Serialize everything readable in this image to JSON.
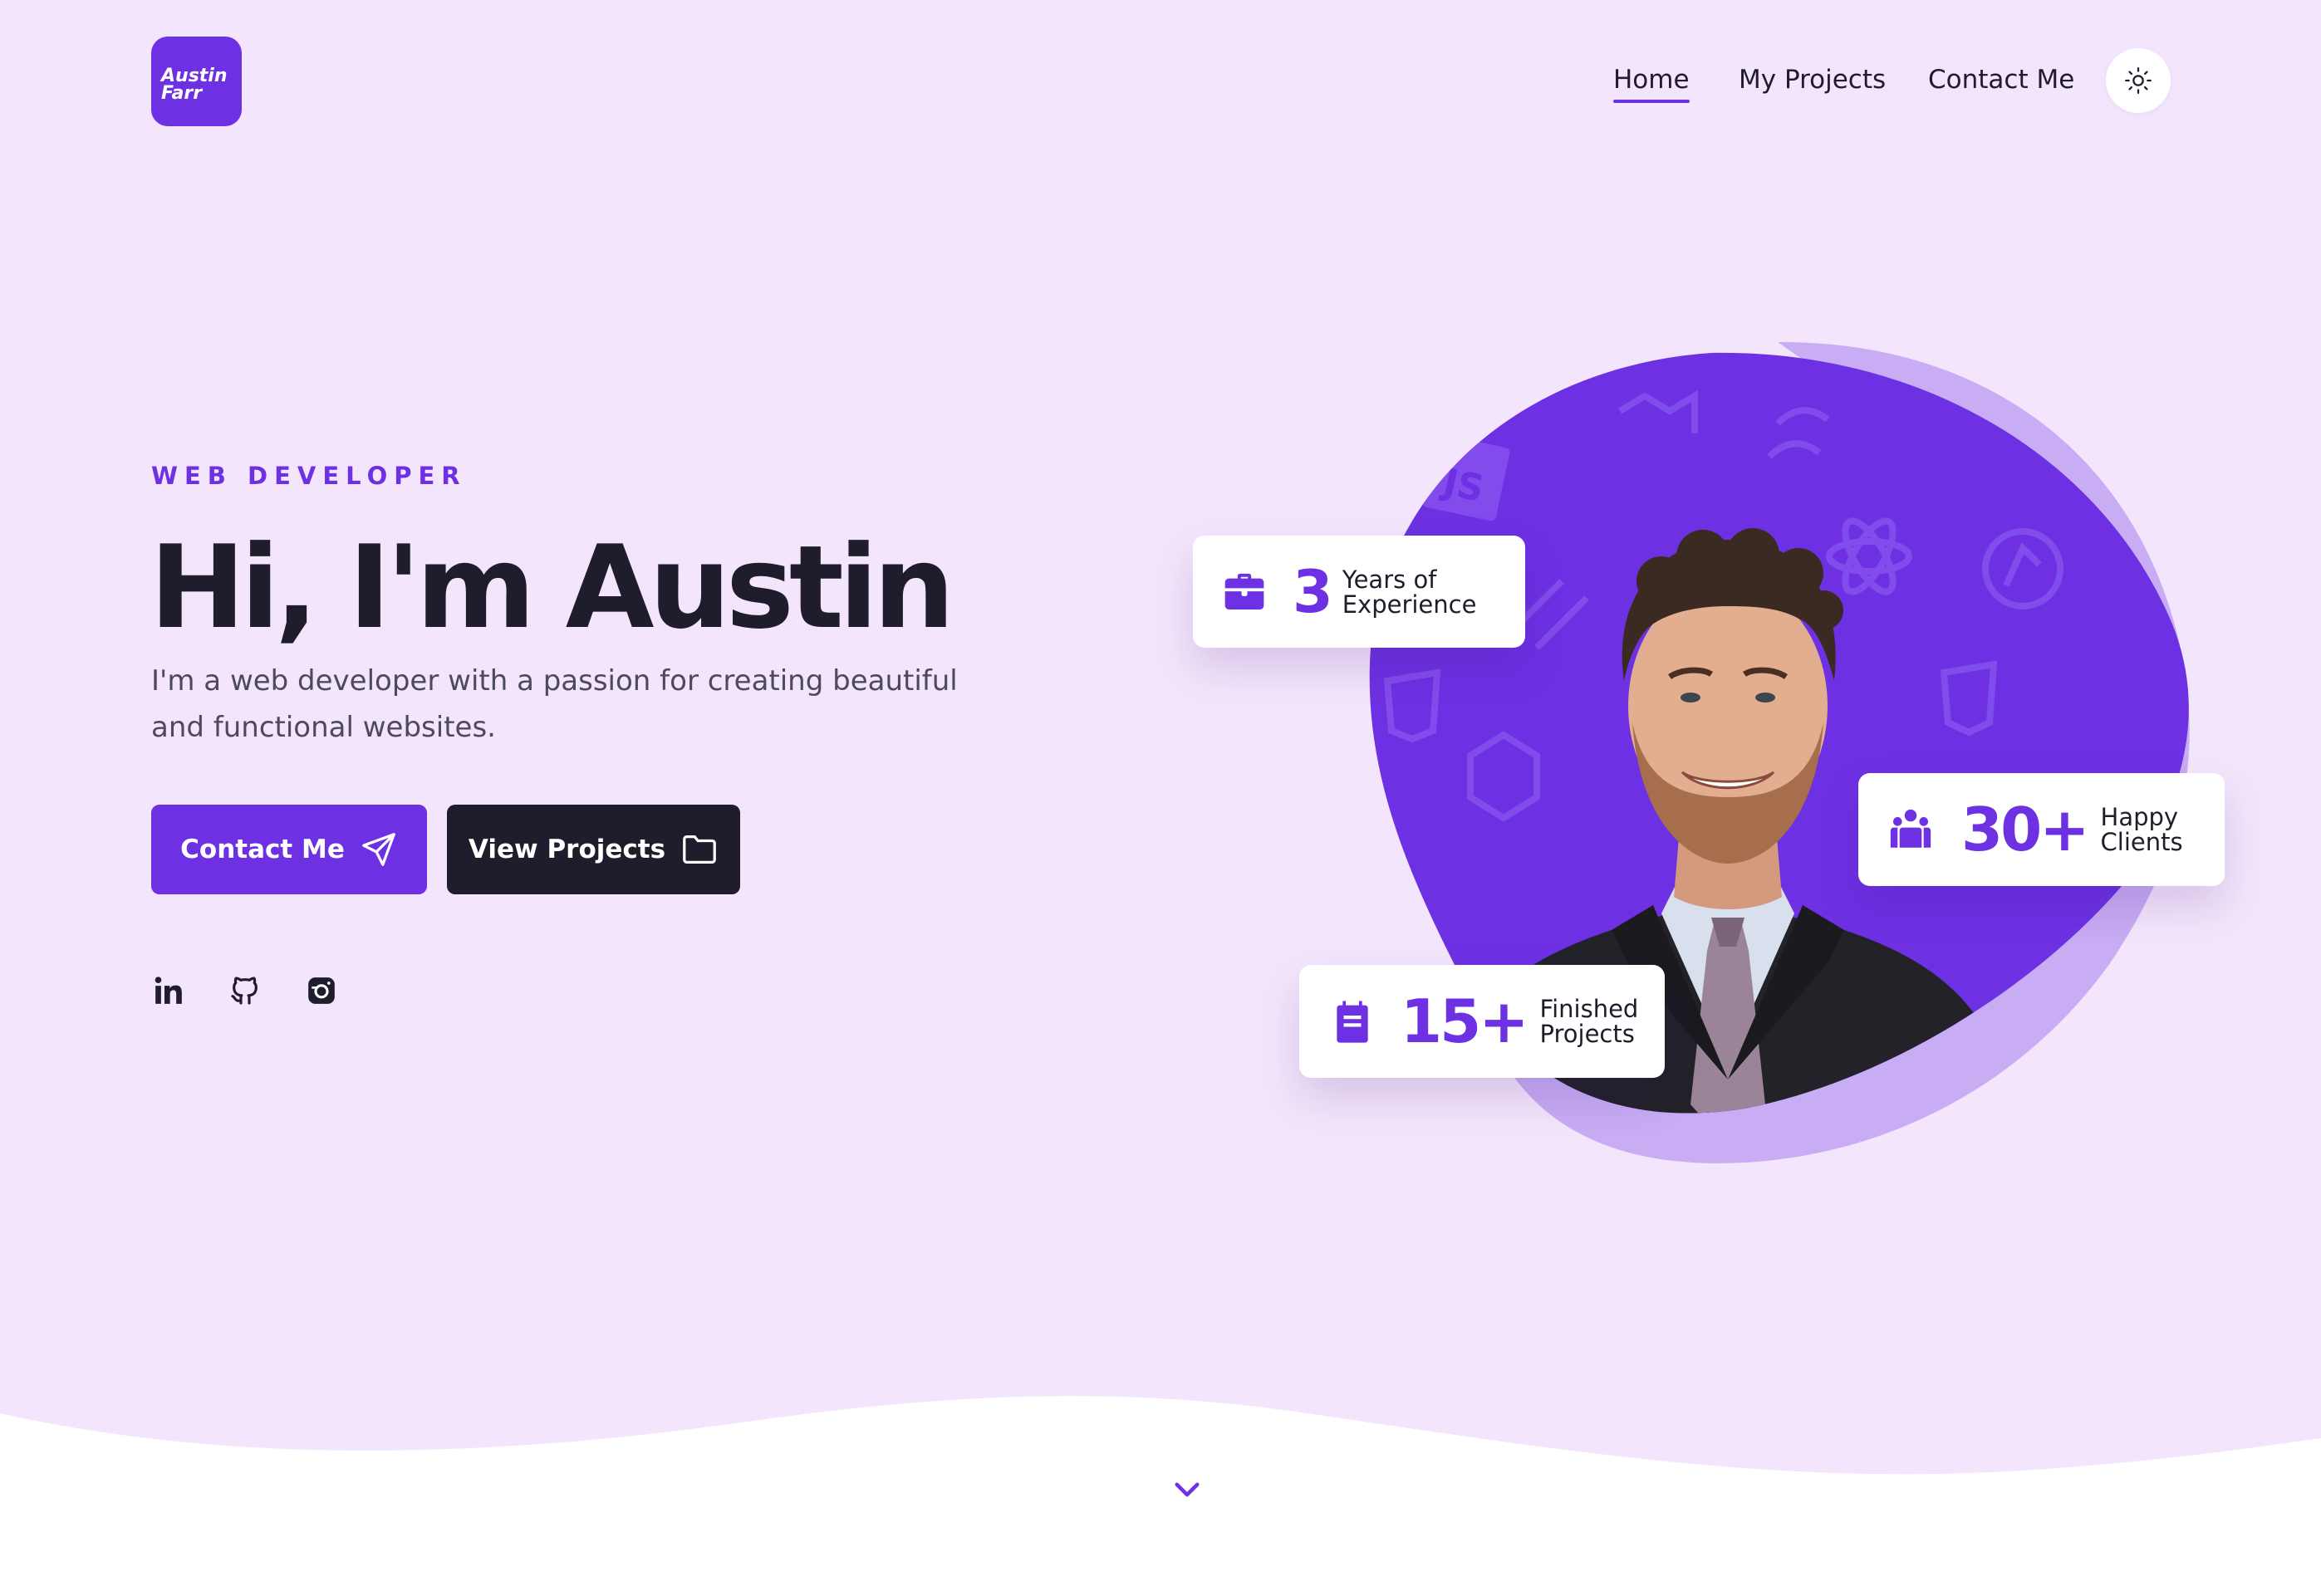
{
  "brand": {
    "line1": "Austin",
    "line2": "Farr",
    "accent": "#6d31e3",
    "dark": "#1f1d2b",
    "background": "#f3e6fc"
  },
  "nav": {
    "items": [
      {
        "label": "Home",
        "active": true
      },
      {
        "label": "My Projects",
        "active": false
      },
      {
        "label": "Contact Me",
        "active": false
      }
    ],
    "theme_toggle_icon": "sun-icon"
  },
  "hero": {
    "eyebrow": "WEB DEVELOPER",
    "headline": "Hi, I'm Austin",
    "subtitle": "I'm a web developer with a passion for creating beautiful and functional websites.",
    "buttons": {
      "contact": {
        "label": "Contact Me",
        "icon": "send-icon"
      },
      "projects": {
        "label": "View Projects",
        "icon": "folder-icon"
      }
    },
    "social": [
      "linkedin-icon",
      "github-icon",
      "instagram-icon"
    ]
  },
  "stats": {
    "experience": {
      "value": "3",
      "line1": "Years of",
      "line2": "Experience",
      "icon": "briefcase-icon"
    },
    "clients": {
      "value": "30+",
      "line1": "Happy",
      "line2": "Clients",
      "icon": "users-icon"
    },
    "projects": {
      "value": "15+",
      "line1": "Finished",
      "line2": "Projects",
      "icon": "clipboard-icon"
    }
  },
  "scroll_icon": "chevron-down-icon"
}
